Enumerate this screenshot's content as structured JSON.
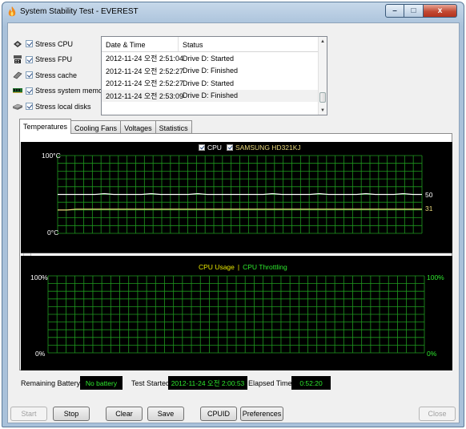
{
  "window": {
    "title": "System Stability Test - EVEREST",
    "controls": {
      "minimize": "–",
      "maximize": "□",
      "close": "x"
    }
  },
  "stress_options": [
    {
      "label": "Stress CPU",
      "icon": "cpu-chip-icon",
      "checked": true
    },
    {
      "label": "Stress FPU",
      "icon": "fpu-icon",
      "checked": true
    },
    {
      "label": "Stress cache",
      "icon": "cache-icon",
      "checked": true
    },
    {
      "label": "Stress system memory",
      "icon": "memory-module-icon",
      "checked": true
    },
    {
      "label": "Stress local disks",
      "icon": "disk-drive-icon",
      "checked": true
    }
  ],
  "log": {
    "columns": [
      "Date & Time",
      "Status"
    ],
    "rows": [
      {
        "date": "2012-11-24 오전 2:51:04",
        "status": "Drive D: Started"
      },
      {
        "date": "2012-11-24 오전 2:52:27",
        "status": "Drive D: Finished"
      },
      {
        "date": "2012-11-24 오전 2:52:27",
        "status": "Drive D: Started"
      },
      {
        "date": "2012-11-24 오전 2:53:09",
        "status": "Drive D: Finished"
      }
    ],
    "scroll_up": "▲",
    "scroll_down": "▼"
  },
  "tabs": [
    "Temperatures",
    "Cooling Fans",
    "Voltages",
    "Statistics"
  ],
  "active_tab": "Temperatures",
  "temp_chart": {
    "legend": [
      {
        "label": "CPU",
        "color": "#ffffff",
        "checked": true
      },
      {
        "label": "SAMSUNG HD321KJ",
        "color": "#e8d77a",
        "checked": true
      }
    ],
    "y_max_label": "100°C",
    "y_min_label": "0°C",
    "value_labels": [
      "50",
      "31"
    ]
  },
  "usage_chart": {
    "legend_usage": "CPU Usage",
    "legend_sep": "|",
    "legend_throttle": "CPU Throttling",
    "y_max_left": "100%",
    "y_min_left": "0%",
    "y_max_right": "100%",
    "y_min_right": "0%"
  },
  "status": {
    "battery_label": "Remaining Battery:",
    "battery_value": "No battery",
    "started_label": "Test Started:",
    "started_value": "2012-11-24 오전 2:00:53",
    "elapsed_label": "Elapsed Time:",
    "elapsed_value": "0:52:20"
  },
  "buttons": {
    "start": "Start",
    "stop": "Stop",
    "clear": "Clear",
    "save": "Save",
    "cpuid": "CPUID",
    "preferences": "Preferences",
    "close": "Close"
  },
  "chart_data": [
    {
      "type": "line",
      "title": "",
      "ylabel": "",
      "ylim": [
        0,
        100
      ],
      "y_unit": "°C",
      "grid": true,
      "legend_placement": "top-center",
      "x_points": 40,
      "series": [
        {
          "name": "CPU",
          "color": "#ffffff",
          "values": [
            50,
            50,
            50,
            50,
            50,
            51,
            50,
            50,
            50,
            50,
            51,
            50,
            50,
            50,
            50,
            51,
            50,
            50,
            50,
            50,
            50,
            50,
            50,
            51,
            50,
            50,
            50,
            50,
            51,
            50,
            50,
            50,
            50,
            51,
            50,
            50,
            50,
            51,
            50,
            50
          ]
        },
        {
          "name": "SAMSUNG HD321KJ",
          "color": "#e8d77a",
          "values": [
            30,
            30,
            31,
            31,
            31,
            31,
            31,
            31,
            31,
            31,
            31,
            31,
            31,
            31,
            31,
            31,
            31,
            31,
            31,
            31,
            31,
            31,
            31,
            31,
            31,
            31,
            31,
            31,
            31,
            31,
            31,
            31,
            31,
            31,
            31,
            31,
            31,
            31,
            31,
            31
          ]
        }
      ]
    },
    {
      "type": "line",
      "title": "",
      "ylabel": "",
      "ylim": [
        0,
        100
      ],
      "y_unit": "%",
      "grid": true,
      "legend_placement": "top-center",
      "series": [
        {
          "name": "CPU Usage",
          "color": "#e8e800",
          "values": []
        },
        {
          "name": "CPU Throttling",
          "color": "#2ee82e",
          "values": []
        }
      ]
    }
  ]
}
